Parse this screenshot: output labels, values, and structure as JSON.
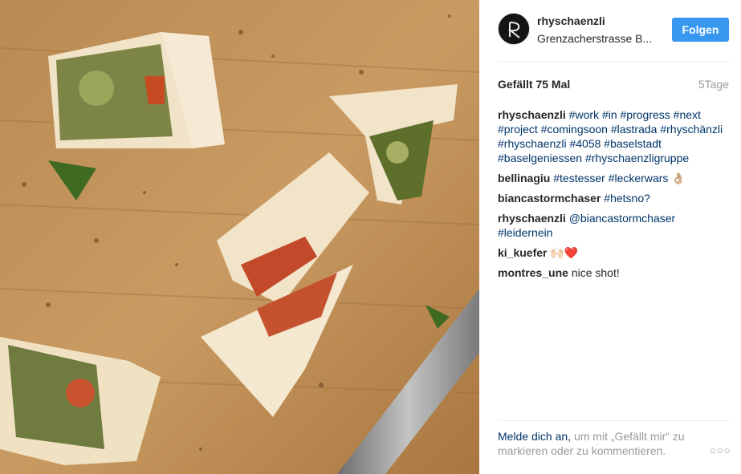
{
  "post": {
    "image_description": "",
    "header": {
      "username": "rhyschaenzli",
      "location": "Grenzacherstrasse B...",
      "follow_label": "Folgen"
    },
    "likes": "Gefällt 75 Mal",
    "age": "5Tage",
    "comments": [
      {
        "author": "rhyschaenzli",
        "text": "#work #in #progress #next #project #comingsoon #lastrada #rhyschänzli #rhyschaenzli #4058 #baselstadt #baselgeniessen #rhyschaenzligruppe",
        "style": "tags"
      },
      {
        "author": "bellinagiu",
        "text": "#testesser #leckerwars 👌🏼",
        "style": "tags"
      },
      {
        "author": "biancastormchaser",
        "text": "#hetsno?",
        "style": "tags"
      },
      {
        "author": "rhyschaenzli",
        "text": "@biancastormchaser #leidernein",
        "style": "tags"
      },
      {
        "author": "ki_kuefer",
        "text": "🙌🏻❤️",
        "style": "plain"
      },
      {
        "author": "montres_une",
        "text": "nice shot!",
        "style": "plain"
      }
    ],
    "footer": {
      "login_link": "Melde dich an,",
      "login_rest": " um mit „Gefällt mir“ zu markieren oder zu kommentieren.",
      "more_label": "○○○"
    },
    "colors": {
      "follow_button": "#3897f0",
      "hashtag": "#003569",
      "muted": "#999999"
    }
  }
}
